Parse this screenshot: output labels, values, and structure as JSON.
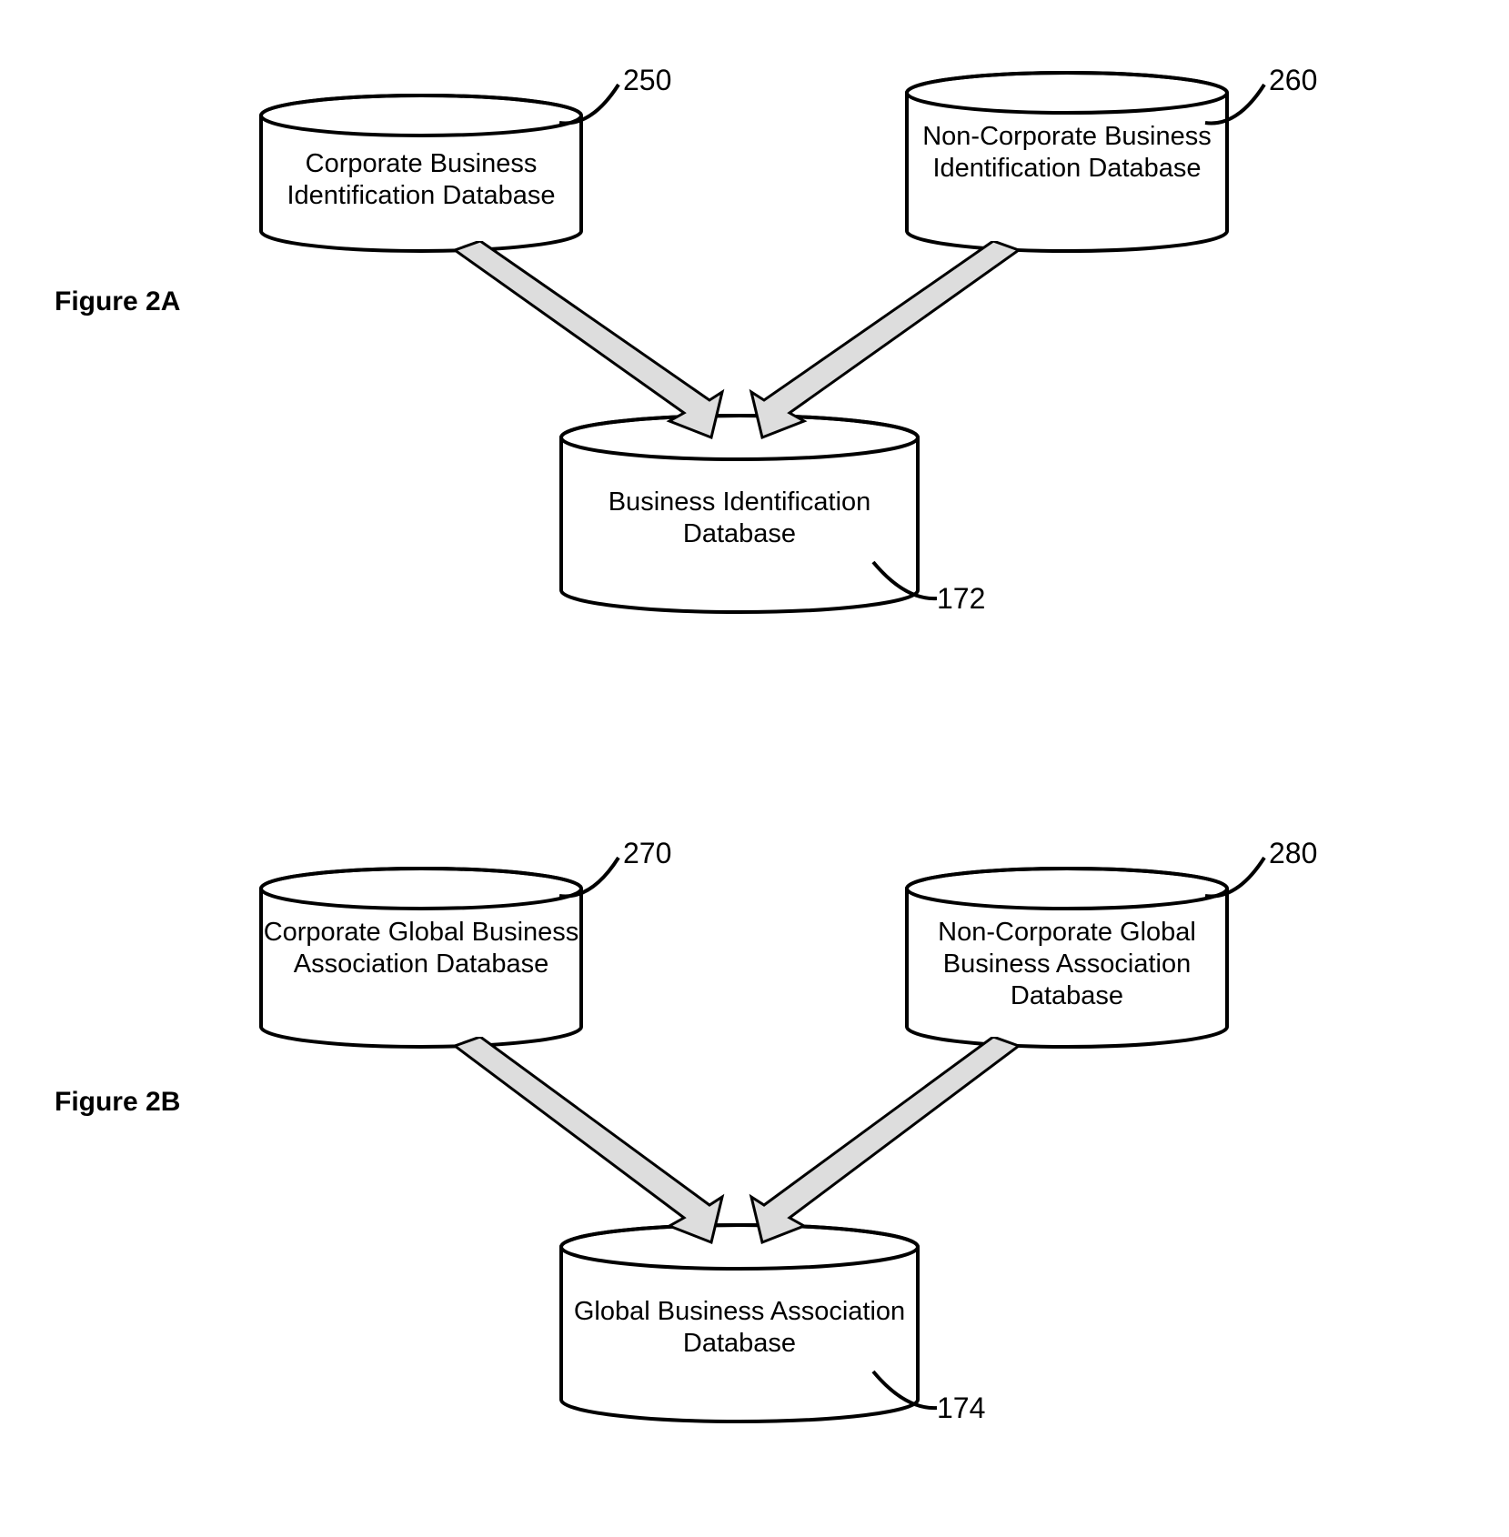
{
  "figures": {
    "a": {
      "label": "Figure 2A"
    },
    "b": {
      "label": "Figure 2B"
    }
  },
  "nodes": {
    "corpBizId": {
      "label": "Corporate Business Identification Database",
      "ref": "250"
    },
    "nonCorpBizId": {
      "label": "Non-Corporate Business Identification Database",
      "ref": "260"
    },
    "bizId": {
      "label": "Business Identification Database",
      "ref": "172"
    },
    "corpGlobalAssoc": {
      "label": "Corporate Global Business Association Database",
      "ref": "270"
    },
    "nonCorpGlobalAssoc": {
      "label": "Non-Corporate Global Business Association Database",
      "ref": "280"
    },
    "globalAssoc": {
      "label": "Global Business Association Database",
      "ref": "174"
    }
  }
}
